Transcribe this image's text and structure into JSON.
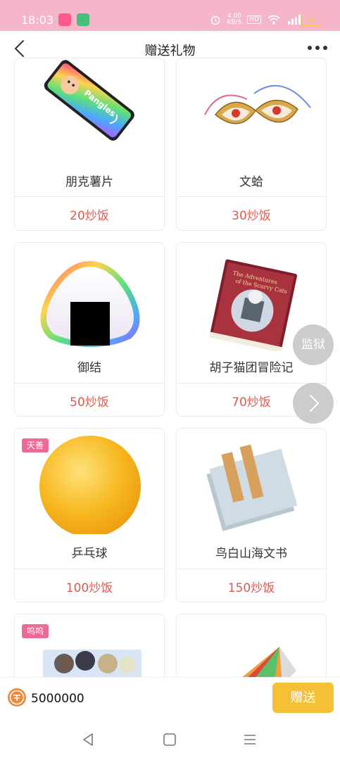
{
  "status_bar": {
    "time": "18:03",
    "network_speed": "4.00\nKB/S",
    "signal": "4G",
    "battery": "82"
  },
  "header": {
    "title": "赠送礼物"
  },
  "gifts": [
    {
      "name": "朋克薯片",
      "price": "20炒饭",
      "badge": ""
    },
    {
      "name": "文蛤",
      "price": "30炒饭",
      "badge": ""
    },
    {
      "name": "御结",
      "price": "50炒饭",
      "badge": ""
    },
    {
      "name": "胡子猫团冒险记",
      "price": "70炒饭",
      "badge": ""
    },
    {
      "name": "乒乓球",
      "price": "100炒饭",
      "badge": "天善"
    },
    {
      "name": "鸟白山海文书",
      "price": "150炒饭",
      "badge": ""
    },
    {
      "name": "",
      "price": "",
      "badge": "呜呜"
    },
    {
      "name": "",
      "price": "",
      "badge": ""
    }
  ],
  "floating": {
    "jail_label": "监狱"
  },
  "footer": {
    "balance": "5000000",
    "send_label": "赠送"
  },
  "colors": {
    "status_bar_bg": "#f4b6c8",
    "price": "#e2574c",
    "send_button": "#f4c036",
    "badge": "#ec6a98"
  }
}
